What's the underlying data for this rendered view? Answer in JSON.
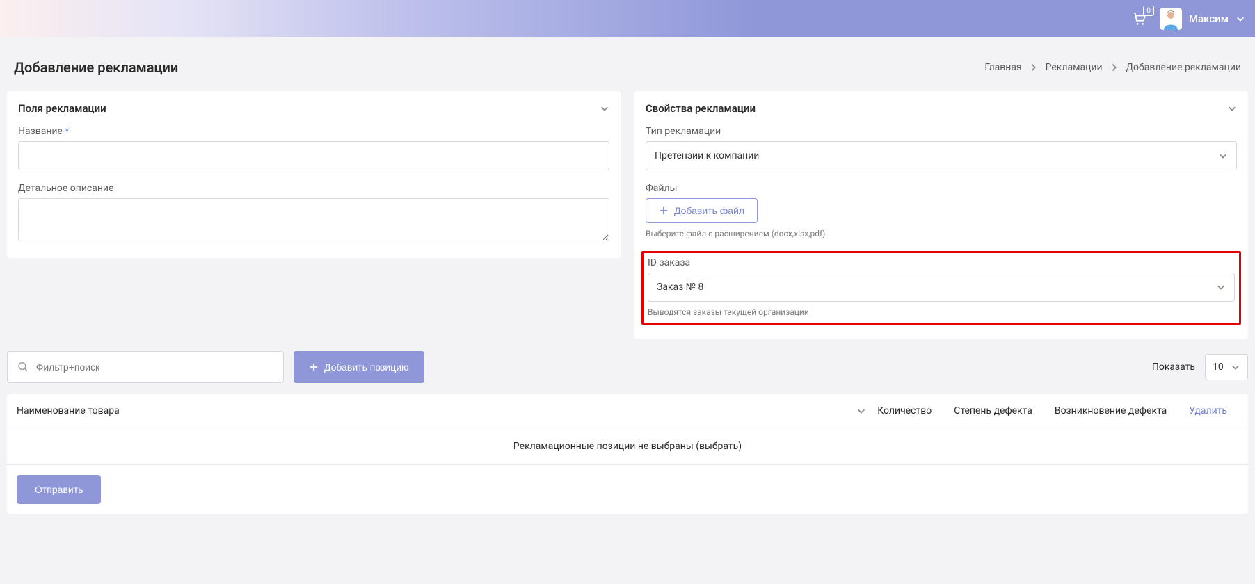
{
  "header": {
    "cart_count": "0",
    "user_name": "Максим"
  },
  "page": {
    "title": "Добавление рекламации",
    "breadcrumb": {
      "home": "Главная",
      "mid": "Рекламации",
      "current": "Добавление рекламации"
    }
  },
  "panel_fields": {
    "title": "Поля рекламации",
    "name_label": "Название",
    "name_required": "*",
    "desc_label": "Детальное описание"
  },
  "panel_props": {
    "title": "Свойства рекламации",
    "type_label": "Тип рекламации",
    "type_value": "Претензии к компании",
    "files_label": "Файлы",
    "add_file_btn": "Добавить файл",
    "file_hint": "Выберите файл с расширением (docx,xlsx,pdf).",
    "order_id_label": "ID заказа",
    "order_id_value": "Заказ № 8",
    "order_hint": "Выводятся заказы текущей организации"
  },
  "controls": {
    "filter_placeholder": "Фильтр+поиск",
    "add_position": "Добавить позицию",
    "show_label": "Показать",
    "show_value": "10"
  },
  "table": {
    "col_name": "Наименование товара",
    "col_qty": "Количество",
    "col_defect": "Степень дефекта",
    "col_origin": "Возникновение дефекта",
    "col_delete": "Удалить",
    "empty_text": "Рекламационные позиции не выбраны ",
    "empty_link": "(выбрать)"
  },
  "footer": {
    "submit": "Отправить"
  }
}
